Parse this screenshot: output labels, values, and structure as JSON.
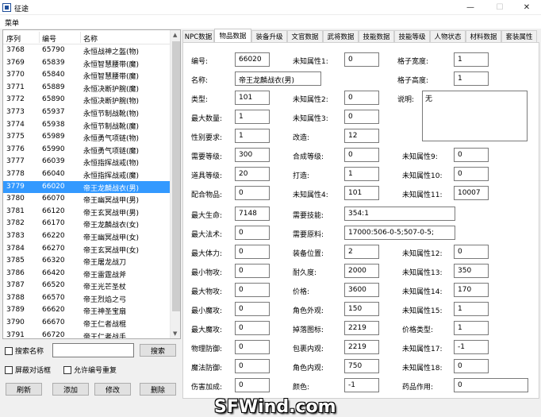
{
  "window": {
    "title": "征途",
    "min": "—",
    "max": "☐",
    "close": "✕"
  },
  "menu": {
    "label": "菜单"
  },
  "list": {
    "headers": [
      "序列",
      "编号",
      "名称"
    ],
    "rows": [
      [
        "3768",
        "65790",
        "永恒战神之盔(物)"
      ],
      [
        "3769",
        "65839",
        "永恒智慧腰带(魔)"
      ],
      [
        "3770",
        "65840",
        "永恒智慧腰带(魔)"
      ],
      [
        "3771",
        "65889",
        "永恒决断护腕(魔)"
      ],
      [
        "3772",
        "65890",
        "永恒决断护腕(物)"
      ],
      [
        "3773",
        "65937",
        "永恒节制战靴(物)"
      ],
      [
        "3774",
        "65938",
        "永恒节制战靴(魔)"
      ],
      [
        "3775",
        "65989",
        "永恒勇气项链(物)"
      ],
      [
        "3776",
        "65990",
        "永恒勇气项链(魔)"
      ],
      [
        "3777",
        "66039",
        "永恒指挥战戒(物)"
      ],
      [
        "3778",
        "66040",
        "永恒指挥战戒(魔)"
      ],
      [
        "3779",
        "66020",
        "帝王龙麟战衣(男)"
      ],
      [
        "3780",
        "66070",
        "帝王幽冥战甲(男)"
      ],
      [
        "3781",
        "66120",
        "帝王玄冥战甲(男)"
      ],
      [
        "3782",
        "66170",
        "帝王龙麟战衣(女)"
      ],
      [
        "3783",
        "66220",
        "帝王幽冥战甲(女)"
      ],
      [
        "3784",
        "66270",
        "帝王玄冥战甲(女)"
      ],
      [
        "3785",
        "66320",
        "帝王屠龙战刀"
      ],
      [
        "3786",
        "66420",
        "帝王雷霆战斧"
      ],
      [
        "3787",
        "66520",
        "帝王光芒圣杖"
      ],
      [
        "3788",
        "66570",
        "帝王烈焰之弓"
      ],
      [
        "3789",
        "66620",
        "帝王神圣宝扇"
      ],
      [
        "3790",
        "66670",
        "帝王仁者战棍"
      ],
      [
        "3791",
        "66720",
        "帝王仁者战手"
      ]
    ],
    "selected_index": 11
  },
  "search": {
    "label": "搜索名称",
    "value": "",
    "button": "搜索"
  },
  "options": {
    "block_dialog": "屏蔽对话框",
    "allow_dup": "允许编号重复"
  },
  "actions": {
    "refresh": "刷新",
    "add": "添加",
    "modify": "修改",
    "delete": "删除"
  },
  "tabs": [
    "NPC数据",
    "物品数据",
    "装备升级",
    "文官数据",
    "武将数据",
    "技能数据",
    "技能等级",
    "人物状态",
    "材料数据",
    "套装属性"
  ],
  "active_tab": 1,
  "fields": {
    "id": {
      "label": "编号:",
      "value": "66020"
    },
    "name": {
      "label": "名称:",
      "value": "帝王龙麟战衣(男)"
    },
    "type": {
      "label": "类型:",
      "value": "101"
    },
    "max_qty": {
      "label": "最大数量:",
      "value": "1"
    },
    "gender": {
      "label": "性别要求:",
      "value": "1"
    },
    "req_level": {
      "label": "需要等级:",
      "value": "300"
    },
    "item_level": {
      "label": "道具等级:",
      "value": "20"
    },
    "combo_item": {
      "label": "配合物品:",
      "value": "0"
    },
    "max_hp": {
      "label": "最大生命:",
      "value": "7148"
    },
    "max_mp": {
      "label": "最大法术:",
      "value": "0"
    },
    "max_sp": {
      "label": "最大体力:",
      "value": "0"
    },
    "min_patk": {
      "label": "最小物攻:",
      "value": "0"
    },
    "max_patk": {
      "label": "最大物攻:",
      "value": "0"
    },
    "min_matk": {
      "label": "最小魔攻:",
      "value": "0"
    },
    "max_matk": {
      "label": "最大魔攻:",
      "value": "0"
    },
    "pdef": {
      "label": "物理防御:",
      "value": "0"
    },
    "mdef": {
      "label": "魔法防御:",
      "value": "0"
    },
    "dmg_bonus": {
      "label": "伤害加成:",
      "value": "0"
    },
    "unk1": {
      "label": "未知属性1:",
      "value": "0"
    },
    "unk2": {
      "label": "未知属性2:",
      "value": "0"
    },
    "unk3": {
      "label": "未知属性3:",
      "value": "0"
    },
    "refine": {
      "label": "改造:",
      "value": "12"
    },
    "compose_level": {
      "label": "合成等级:",
      "value": "0"
    },
    "forge": {
      "label": "打造:",
      "value": "1"
    },
    "unk4": {
      "label": "未知属性4:",
      "value": "101"
    },
    "req_skill": {
      "label": "需要技能:",
      "value": "354:1"
    },
    "req_material": {
      "label": "需要原料:",
      "value": "17000:506-0-5;507-0-5;"
    },
    "equip_pos": {
      "label": "装备位置:",
      "value": "2"
    },
    "durability": {
      "label": "耐久度:",
      "value": "2000"
    },
    "price": {
      "label": "价格:",
      "value": "3600"
    },
    "appearance": {
      "label": "角色外观:",
      "value": "150"
    },
    "drop_icon": {
      "label": "掉落图标:",
      "value": "2219"
    },
    "pack_look": {
      "label": "包裹内观:",
      "value": "2219"
    },
    "role_look": {
      "label": "角色内观:",
      "value": "750"
    },
    "color": {
      "label": "颜色:",
      "value": "-1"
    },
    "slot_width": {
      "label": "格子宽度:",
      "value": "1"
    },
    "slot_height": {
      "label": "格子高度:",
      "value": "1"
    },
    "desc": {
      "label": "说明:",
      "value": "无"
    },
    "unk9": {
      "label": "未知属性9:",
      "value": "0"
    },
    "unk10": {
      "label": "未知属性10:",
      "value": "0"
    },
    "unk11": {
      "label": "未知属性11:",
      "value": "10007"
    },
    "unk12": {
      "label": "未知属性12:",
      "value": "0"
    },
    "unk13": {
      "label": "未知属性13:",
      "value": "350"
    },
    "unk14": {
      "label": "未知属性14:",
      "value": "170"
    },
    "unk15": {
      "label": "未知属性15:",
      "value": "1"
    },
    "price_type": {
      "label": "价格类型:",
      "value": "1"
    },
    "unk17": {
      "label": "未知属性17:",
      "value": "-1"
    },
    "unk18": {
      "label": "未知属性18:",
      "value": "0"
    },
    "potion_effect": {
      "label": "药品作用:",
      "value": "0"
    }
  },
  "watermark": "SFWind.com"
}
